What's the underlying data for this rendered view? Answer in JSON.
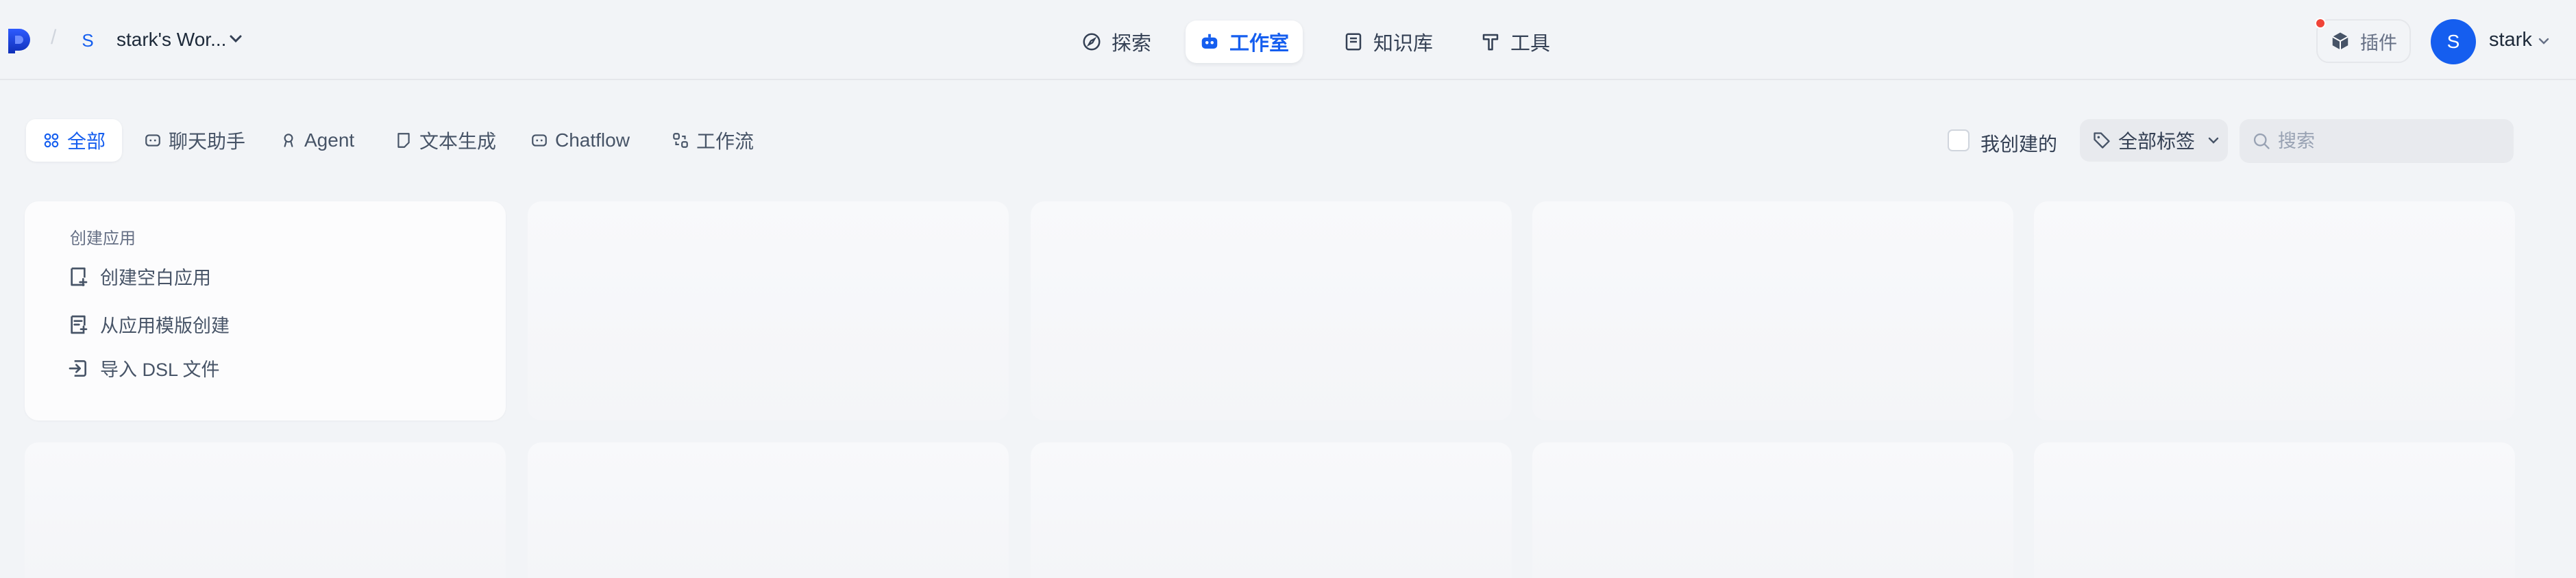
{
  "header": {
    "workspace_initial": "S",
    "workspace_name": "stark's Wor...",
    "nav": [
      {
        "label": "探索",
        "icon": "compass-icon",
        "active": false
      },
      {
        "label": "工作室",
        "icon": "robot-icon",
        "active": true
      },
      {
        "label": "知识库",
        "icon": "book-icon",
        "active": false
      },
      {
        "label": "工具",
        "icon": "hammer-icon",
        "active": false
      }
    ],
    "plugins_label": "插件",
    "user_initial": "S",
    "user_name": "stark"
  },
  "filters": {
    "tabs": [
      {
        "label": "全部",
        "icon": "grid-icon",
        "active": true
      },
      {
        "label": "聊天助手",
        "icon": "chat-bubble-icon",
        "active": false
      },
      {
        "label": "Agent",
        "icon": "agent-icon",
        "active": false
      },
      {
        "label": "文本生成",
        "icon": "document-icon",
        "active": false
      },
      {
        "label": "Chatflow",
        "icon": "chatflow-icon",
        "active": false
      },
      {
        "label": "工作流",
        "icon": "workflow-icon",
        "active": false
      }
    ],
    "mine_label": "我创建的",
    "mine_checked": false,
    "tags_label": "全部标签",
    "search_placeholder": "搜索"
  },
  "create_card": {
    "title": "创建应用",
    "items": [
      {
        "label": "创建空白应用",
        "icon": "file-plus-icon"
      },
      {
        "label": "从应用模版创建",
        "icon": "template-icon"
      },
      {
        "label": "导入 DSL 文件",
        "icon": "import-icon"
      }
    ]
  },
  "colors": {
    "accent": "#155eef",
    "background": "#f2f4f7",
    "notification": "#f04438"
  }
}
